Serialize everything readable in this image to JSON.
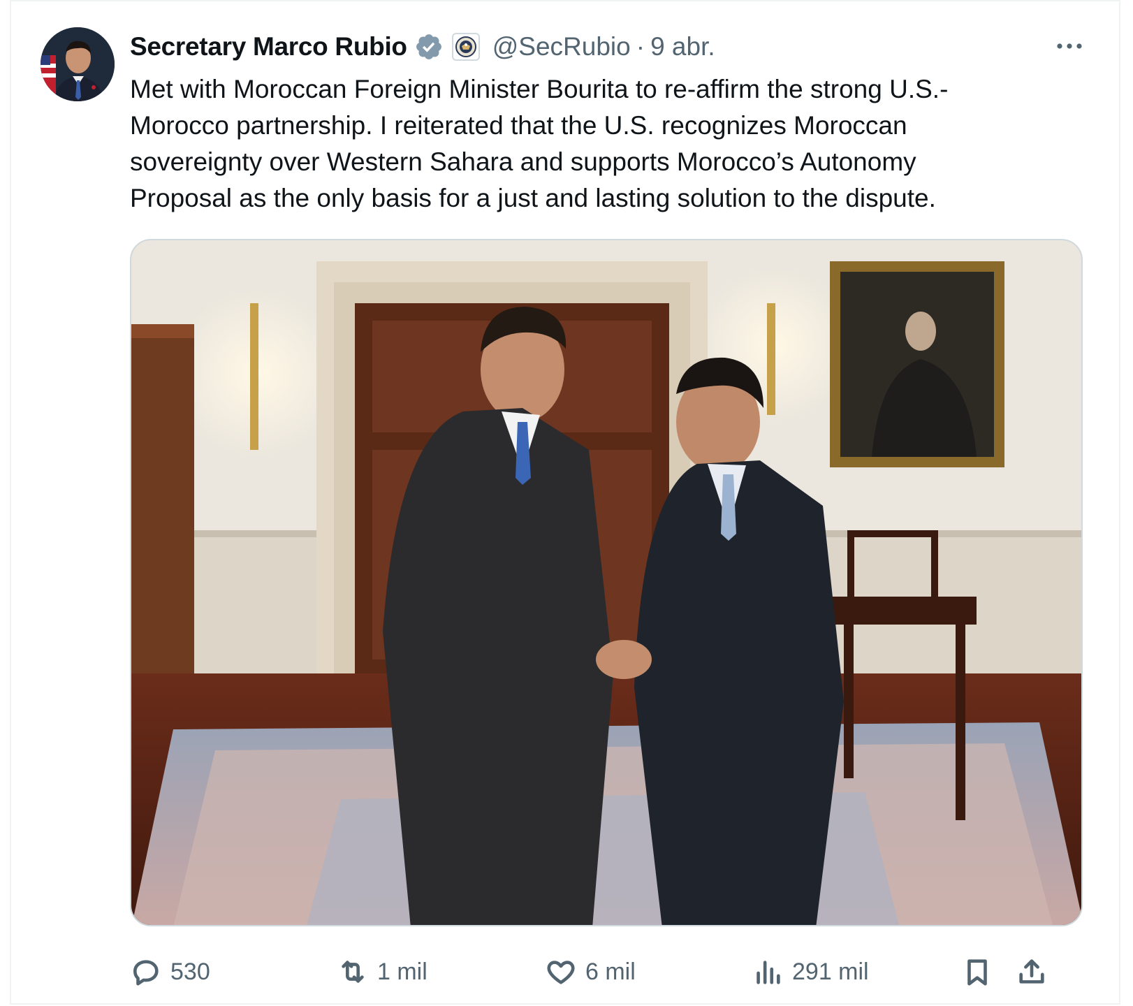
{
  "tweet": {
    "author": {
      "display_name": "Secretary Marco Rubio",
      "handle": "@SecRubio",
      "verified_badge_color": "#829aab",
      "date": "9 abr.",
      "separator": "·"
    },
    "text_lines": [
      "Met with Moroccan Foreign Minister Bourita to re-affirm the strong U.S.-",
      "Morocco partnership. I reiterated that the U.S. recognizes Moroccan",
      "sovereignty over Western Sahara and supports Morocco’s Autonomy",
      "Proposal as the only basis for a just and lasting solution to the dispute."
    ],
    "more_icon": "more-horizontal-icon"
  },
  "actions": {
    "replies": {
      "icon": "reply-icon",
      "count": "530"
    },
    "reposts": {
      "icon": "repost-icon",
      "count": "1 mil"
    },
    "likes": {
      "icon": "heart-icon",
      "count": "6 mil"
    },
    "views": {
      "icon": "analytics-icon",
      "count": "291 mil"
    },
    "bookmark": {
      "icon": "bookmark-icon"
    },
    "share": {
      "icon": "share-icon"
    }
  },
  "colors": {
    "text_primary": "#0f1419",
    "text_secondary": "#536471",
    "border": "#cfd9de"
  }
}
